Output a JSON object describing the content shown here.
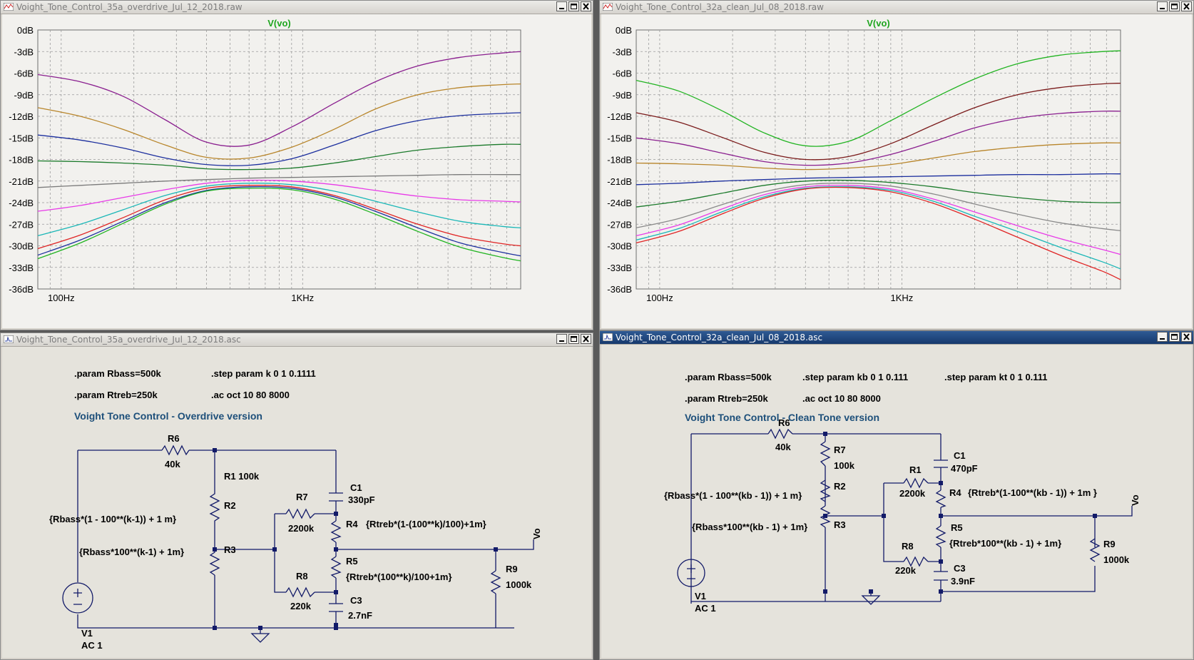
{
  "colors": {
    "plot_bg": "#f2f1ee",
    "grid": "#9a9a9a",
    "schematic_bg": "#e5e3dc",
    "wire": "#121a68",
    "trace_title": "#1fa51f",
    "comment_text": "#1d4f7a",
    "active_titlebar": "#1f4580"
  },
  "windows": {
    "plot_left": {
      "title": "Voight_Tone_Control_35a_overdrive_Jul_12_2018.raw",
      "trace_name": "V(vo)"
    },
    "plot_right": {
      "title": "Voight_Tone_Control_32a_clean_Jul_08_2018.raw",
      "trace_name": "V(vo)"
    },
    "sch_left": {
      "title": "Voight_Tone_Control_35a_overdrive_Jul_12_2018.asc",
      "directive_1": ".param Rbass=500k",
      "directive_2": ".param Rtreb=250k",
      "directive_3": ".step param k 0 1 0.1111",
      "directive_4": ".ac oct 10 80 8000",
      "comment": "Voight Tone Control - Overdrive version",
      "labels": {
        "r6": "R6",
        "r6v": "40k",
        "r1": "R1 100k",
        "r2": "R2",
        "r3": "R3",
        "r7": "R7",
        "r7v": "2200k",
        "r8": "R8",
        "r8v": "220k",
        "c1": "C1",
        "c1v": "330pF",
        "r4": "R4",
        "r4expr": "{Rtreb*(1-(100**k)/100)+1m}",
        "r5": "R5",
        "r5expr": "{Rtreb*(100**k)/100+1m}",
        "c3": "C3",
        "c3v": "2.7nF",
        "r9": "R9",
        "r9v": "1000k",
        "vo": "Vo",
        "v1": "V1",
        "v1v": "AC 1",
        "r2expr": "{Rbass*(1 - 100**(k-1)) + 1 m}",
        "r3expr": "{Rbass*100**(k-1) + 1m}"
      }
    },
    "sch_right": {
      "title": "Voight_Tone_Control_32a_clean_Jul_08_2018.asc",
      "directive_1": ".param Rbass=500k",
      "directive_2": ".param Rtreb=250k",
      "directive_3": ".step param kb 0 1 0.111",
      "directive_4": ".ac oct 10 80 8000",
      "directive_5": ".step param kt 0 1 0.111",
      "comment": "Voight Tone Control - Clean Tone version",
      "labels": {
        "r6": "R6",
        "r6v": "40k",
        "r7": "R7",
        "r7v": "100k",
        "r2": "R2",
        "r3": "R3",
        "r2expr": "{Rbass*(1 - 100**(kb - 1)) + 1 m}",
        "r3expr": "{Rbass*100**(kb - 1) + 1m}",
        "r1": "R1",
        "r1v": "2200k",
        "r8": "R8",
        "r8v": "220k",
        "c1": "C1",
        "c1v": "470pF",
        "r4": "R4",
        "r4expr": "{Rtreb*(1-100**(kb - 1)) + 1m }",
        "r5": "R5",
        "r5expr": "{Rtreb*100**(kb - 1) + 1m}",
        "c3": "C3",
        "c3v": "3.9nF",
        "r9": "R9",
        "r9v": "1000k",
        "vo": "Vo",
        "v1": "V1",
        "v1v": "AC 1"
      }
    }
  },
  "chart_data": [
    {
      "type": "line",
      "title": "V(vo)",
      "xscale": "log",
      "xlim": [
        80,
        8000
      ],
      "ylim": [
        -36,
        0
      ],
      "ylabel_unit": "dB",
      "y_ticks": [
        "0dB",
        "-3dB",
        "-6dB",
        "-9dB",
        "-12dB",
        "-15dB",
        "-18dB",
        "-21dB",
        "-24dB",
        "-27dB",
        "-30dB",
        "-33dB",
        "-36dB"
      ],
      "x_ticks": [
        {
          "v": 100,
          "label": "100Hz"
        },
        {
          "v": 1000,
          "label": "1KHz"
        }
      ],
      "x": [
        80,
        120,
        180,
        270,
        400,
        600,
        900,
        1350,
        2000,
        3000,
        4500,
        6700,
        8000
      ],
      "series": [
        {
          "color": "#8a1f8f",
          "values": [
            -6.2,
            -7.2,
            -9.2,
            -12.5,
            -15.6,
            -16.0,
            -13.5,
            -10.2,
            -7.2,
            -5.0,
            -3.8,
            -3.2,
            -3.0
          ]
        },
        {
          "color": "#b8852a",
          "values": [
            -10.8,
            -12.0,
            -13.8,
            -16.0,
            -17.7,
            -17.8,
            -16.3,
            -13.8,
            -11.0,
            -9.0,
            -8.0,
            -7.6,
            -7.5
          ]
        },
        {
          "color": "#1c2f9e",
          "values": [
            -14.6,
            -15.3,
            -16.4,
            -17.8,
            -18.7,
            -18.8,
            -17.9,
            -16.0,
            -14.0,
            -12.6,
            -11.9,
            -11.6,
            -11.5
          ]
        },
        {
          "color": "#1b7a2b",
          "values": [
            -18.2,
            -18.3,
            -18.5,
            -18.8,
            -19.3,
            -19.4,
            -19.2,
            -18.5,
            -17.6,
            -16.7,
            -16.2,
            -15.9,
            -15.9
          ]
        },
        {
          "color": "#7a7a7a",
          "values": [
            -21.9,
            -21.6,
            -21.3,
            -21.0,
            -20.8,
            -20.6,
            -20.5,
            -20.4,
            -20.3,
            -20.2,
            -20.1,
            -20.1,
            -20.1
          ]
        },
        {
          "color": "#e83be8",
          "values": [
            -25.2,
            -24.4,
            -23.3,
            -22.2,
            -21.3,
            -20.9,
            -21.0,
            -21.5,
            -22.3,
            -23.1,
            -23.6,
            -23.8,
            -23.9
          ]
        },
        {
          "color": "#1ab7b7",
          "values": [
            -28.6,
            -27.0,
            -25.0,
            -23.0,
            -21.7,
            -21.3,
            -21.5,
            -22.4,
            -23.8,
            -25.3,
            -26.6,
            -27.3,
            -27.5
          ]
        },
        {
          "color": "#e02525",
          "values": [
            -30.4,
            -28.5,
            -26.1,
            -23.6,
            -22.0,
            -21.6,
            -21.8,
            -23.0,
            -24.9,
            -27.0,
            -28.7,
            -29.7,
            -30.0
          ]
        },
        {
          "color": "#1c2f9e",
          "values": [
            -31.3,
            -29.2,
            -26.6,
            -24.0,
            -22.3,
            -21.8,
            -22.0,
            -23.2,
            -25.2,
            -27.5,
            -29.6,
            -30.9,
            -31.4
          ]
        },
        {
          "color": "#22b422",
          "values": [
            -31.8,
            -29.6,
            -26.9,
            -24.2,
            -22.4,
            -22.0,
            -22.2,
            -23.5,
            -25.6,
            -28.0,
            -30.2,
            -31.6,
            -32.1
          ]
        }
      ]
    },
    {
      "type": "line",
      "title": "V(vo)",
      "xscale": "log",
      "xlim": [
        80,
        8000
      ],
      "ylim": [
        -36,
        0
      ],
      "ylabel_unit": "dB",
      "y_ticks": [
        "0dB",
        "-3dB",
        "-6dB",
        "-9dB",
        "-12dB",
        "-15dB",
        "-18dB",
        "-21dB",
        "-24dB",
        "-27dB",
        "-30dB",
        "-33dB",
        "-36dB"
      ],
      "x_ticks": [
        {
          "v": 100,
          "label": "100Hz"
        },
        {
          "v": 1000,
          "label": "1KHz"
        }
      ],
      "x": [
        80,
        120,
        180,
        270,
        400,
        600,
        900,
        1350,
        2000,
        3000,
        4500,
        6700,
        8000
      ],
      "series": [
        {
          "color": "#22b422",
          "values": [
            -7.0,
            -8.5,
            -11.2,
            -14.3,
            -16.1,
            -15.5,
            -12.6,
            -9.5,
            -6.8,
            -4.7,
            -3.5,
            -3.0,
            -2.9
          ]
        },
        {
          "color": "#7a1a1a",
          "values": [
            -11.5,
            -12.8,
            -14.9,
            -17.0,
            -18.0,
            -17.6,
            -15.8,
            -13.2,
            -10.8,
            -9.0,
            -8.0,
            -7.5,
            -7.4
          ]
        },
        {
          "color": "#8a1f8f",
          "values": [
            -15.0,
            -15.8,
            -17.1,
            -18.3,
            -18.8,
            -18.5,
            -17.3,
            -15.5,
            -13.6,
            -12.3,
            -11.6,
            -11.3,
            -11.3
          ]
        },
        {
          "color": "#b8852a",
          "values": [
            -18.5,
            -18.6,
            -18.8,
            -19.2,
            -19.4,
            -19.2,
            -18.7,
            -17.8,
            -16.9,
            -16.3,
            -15.9,
            -15.7,
            -15.7
          ]
        },
        {
          "color": "#1c2f9e",
          "values": [
            -21.5,
            -21.3,
            -21.0,
            -20.8,
            -20.6,
            -20.5,
            -20.4,
            -20.3,
            -20.2,
            -20.1,
            -20.1,
            -20.0,
            -20.0
          ]
        },
        {
          "color": "#1b7a2b",
          "values": [
            -24.6,
            -23.8,
            -22.7,
            -21.6,
            -21.0,
            -20.9,
            -21.2,
            -21.8,
            -22.6,
            -23.3,
            -23.8,
            -24.0,
            -24.0
          ]
        },
        {
          "color": "#8a8a8a",
          "values": [
            -27.5,
            -26.2,
            -24.3,
            -22.5,
            -21.5,
            -21.3,
            -21.7,
            -22.8,
            -24.2,
            -25.6,
            -26.8,
            -27.6,
            -27.9
          ]
        },
        {
          "color": "#e83be8",
          "values": [
            -28.6,
            -27.1,
            -24.9,
            -22.9,
            -21.8,
            -21.6,
            -22.1,
            -23.5,
            -25.3,
            -27.2,
            -29.0,
            -30.5,
            -31.2
          ]
        },
        {
          "color": "#1ab7b7",
          "values": [
            -29.2,
            -27.6,
            -25.3,
            -23.2,
            -22.0,
            -21.8,
            -22.3,
            -23.8,
            -25.9,
            -28.0,
            -30.2,
            -32.2,
            -33.2
          ]
        },
        {
          "color": "#e02525",
          "values": [
            -29.6,
            -28.0,
            -25.6,
            -23.4,
            -22.1,
            -21.9,
            -22.5,
            -24.1,
            -26.3,
            -28.8,
            -31.3,
            -33.5,
            -34.7
          ]
        }
      ]
    }
  ]
}
